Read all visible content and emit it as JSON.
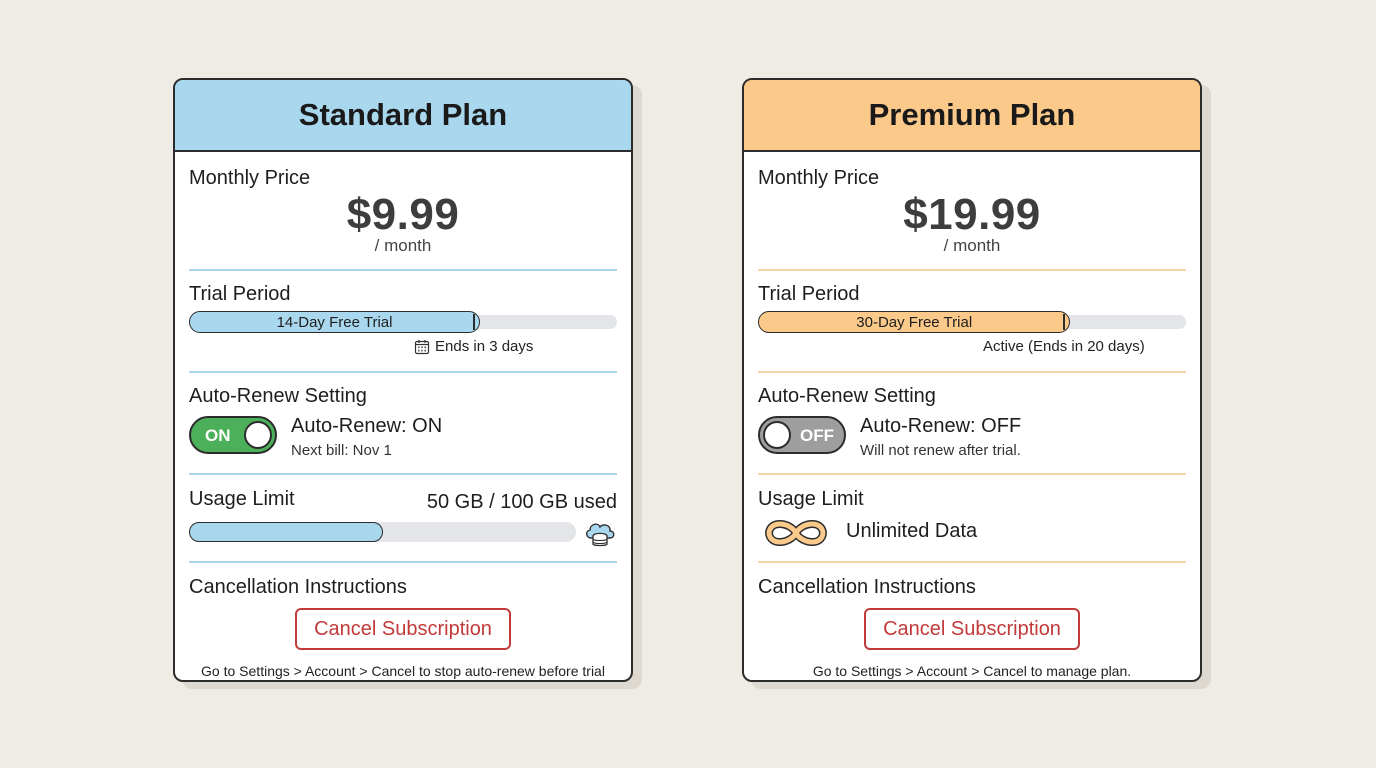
{
  "colors": {
    "standard_accent": "#a9d8ee",
    "standard_divider": "#a9d8ee",
    "premium_accent": "#fbc98a",
    "premium_divider": "#f3d4a8",
    "toggle_on": "#4caf5a",
    "toggle_off": "#9e9e9e",
    "cancel_red": "#c23a3a"
  },
  "plans": [
    {
      "title": "Standard Plan",
      "price_label": "Monthly Price",
      "price": "$9.99",
      "period": "/ month",
      "trial_label": "Trial Period",
      "trial_bar_text": "14-Day Free Trial",
      "trial_progress": 0.68,
      "trial_status": "Ends in 3 days",
      "trial_status_icon": "calendar-icon",
      "renew_label": "Auto-Renew Setting",
      "toggle_text": "ON",
      "renew_on": true,
      "renew_status": "Auto-Renew: ON",
      "renew_sub": "Next bill: Nov 1",
      "usage_label": "Usage Limit",
      "usage_value": "50 GB / 100 GB used",
      "usage_fraction": 0.5,
      "usage_icon": "cloud-storage-icon",
      "cancel_label": "Cancellation Instructions",
      "cancel_button": "Cancel Subscription",
      "cancel_note": "Go to Settings > Account > Cancel to stop auto-renew before trial ends."
    },
    {
      "title": "Premium Plan",
      "price_label": "Monthly Price",
      "price": "$19.99",
      "period": "/ month",
      "trial_label": "Trial Period",
      "trial_bar_text": "30-Day Free Trial",
      "trial_progress": 0.73,
      "trial_status": "Active (Ends in 20 days)",
      "renew_label": "Auto-Renew Setting",
      "toggle_text": "OFF",
      "renew_on": false,
      "renew_status": "Auto-Renew: OFF",
      "renew_sub": "Will not renew after trial.",
      "usage_label": "Usage Limit",
      "usage_value": "Unlimited Data",
      "usage_icon": "infinity-icon",
      "cancel_label": "Cancellation Instructions",
      "cancel_button": "Cancel Subscription",
      "cancel_note": "Go to Settings > Account > Cancel to manage plan."
    }
  ]
}
